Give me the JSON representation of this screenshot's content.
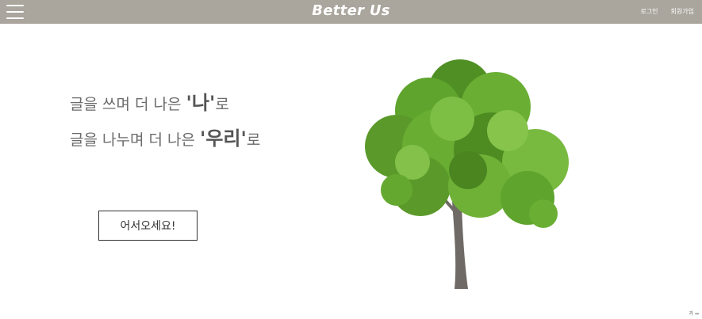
{
  "header": {
    "brand": "Better Us",
    "login_label": "로그인",
    "signup_label": "회원가입"
  },
  "hero": {
    "line1_prefix": "글을 쓰며 더 나은 ",
    "line1_highlight": "'나'",
    "line1_suffix": "로",
    "line2_prefix": "글을 나누며 더 나은 ",
    "line2_highlight": "'우리'",
    "line2_suffix": "로",
    "button_label": "어서오세요!"
  },
  "corner": {
    "label": "가 ↔"
  },
  "colors": {
    "topbar": "#aaa59d",
    "text": "#6b6b6b",
    "leaf": "#5b9a2a",
    "trunk": "#6f6a66"
  },
  "icons": {
    "menu": "hamburger-menu-icon",
    "tree": "tree-illustration"
  }
}
